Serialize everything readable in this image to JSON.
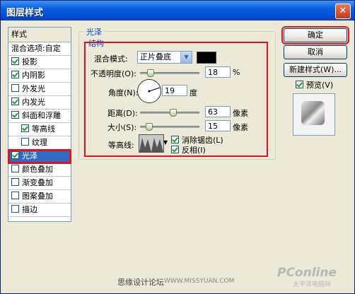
{
  "window": {
    "title": "图层样式",
    "close_glyph": "✕"
  },
  "styles_list": {
    "header": "样式",
    "blend_options": "混合选项:自定",
    "items": [
      {
        "label": "投影",
        "checked": true
      },
      {
        "label": "内阴影",
        "checked": true
      },
      {
        "label": "外发光",
        "checked": false
      },
      {
        "label": "内发光",
        "checked": true
      },
      {
        "label": "斜面和浮雕",
        "checked": true
      },
      {
        "label": "等高线",
        "checked": true
      },
      {
        "label": "纹理",
        "checked": false
      },
      {
        "label": "光泽",
        "checked": true,
        "selected": true
      },
      {
        "label": "颜色叠加",
        "checked": false
      },
      {
        "label": "渐变叠加",
        "checked": false
      },
      {
        "label": "图案叠加",
        "checked": false
      },
      {
        "label": "描边",
        "checked": false
      }
    ]
  },
  "satin": {
    "group_title": "光泽",
    "structure_title": "结构",
    "blend_mode_label": "混合模式:",
    "blend_mode_value": "正片叠底",
    "blend_color": "#000000",
    "opacity_label": "不透明度(O):",
    "opacity_value": "18",
    "opacity_unit": "%",
    "angle_label": "角度(N):",
    "angle_value": "19",
    "angle_unit": "度",
    "distance_label": "距离(D):",
    "distance_value": "63",
    "distance_unit": "像素",
    "size_label": "大小(S):",
    "size_value": "15",
    "size_unit": "像素",
    "contour_label": "等高线:",
    "anti_alias_label": "消除锯齿(L)",
    "anti_alias_checked": true,
    "invert_label": "反相(I)",
    "invert_checked": true
  },
  "buttons": {
    "ok": "确定",
    "cancel": "取消",
    "new_style": "新建样式(W)...",
    "preview_label": "预览(V)",
    "preview_checked": true
  },
  "footer": {
    "forum": "思缘设计论坛",
    "url": "WWW.MISSYUAN.COM",
    "logo": "PConline",
    "logo_sub": "太平洋电脑网"
  }
}
